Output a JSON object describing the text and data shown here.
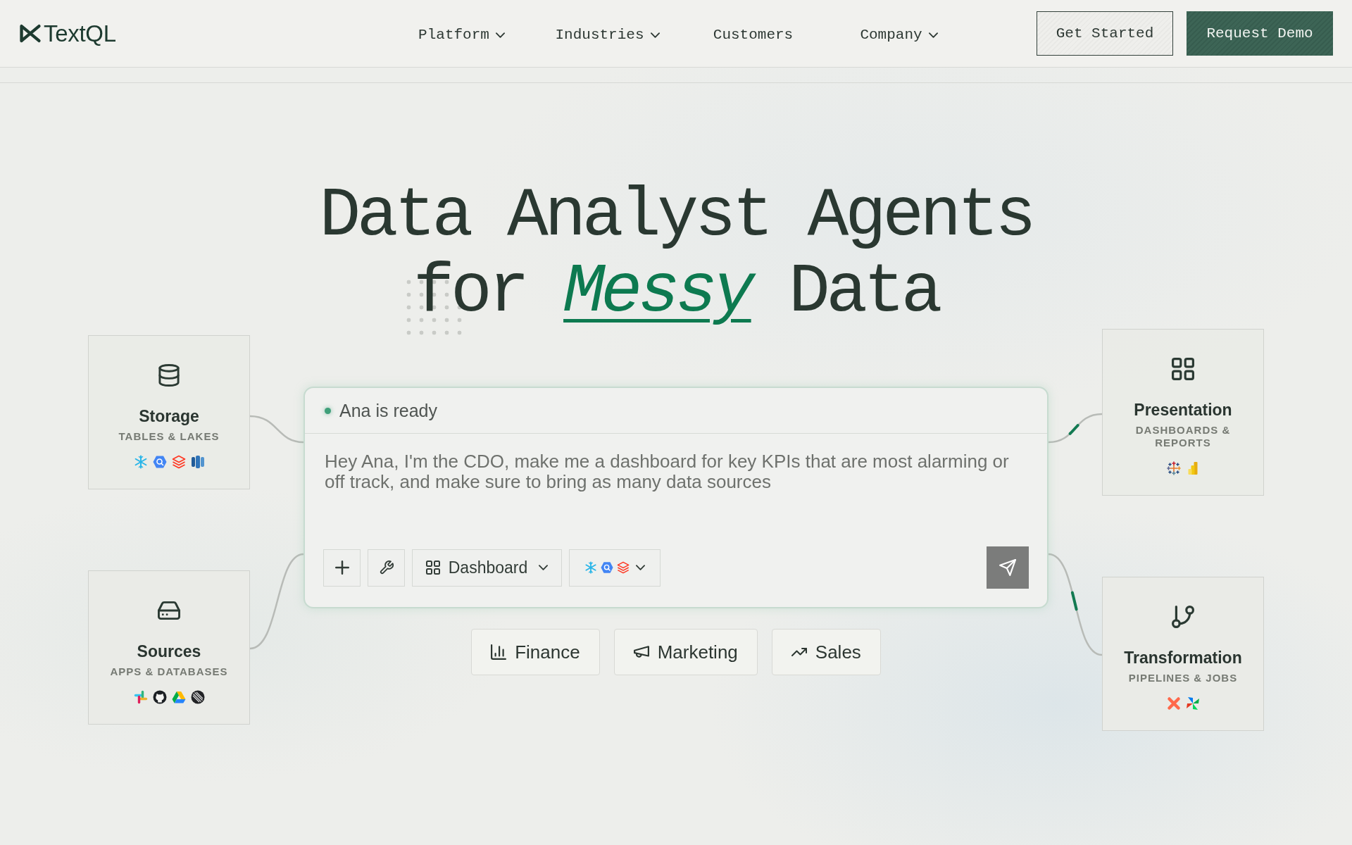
{
  "nav": {
    "logo": "TextQL",
    "links": [
      {
        "label": "Platform",
        "dropdown": true
      },
      {
        "label": "Industries",
        "dropdown": true
      },
      {
        "label": "Customers",
        "dropdown": false
      },
      {
        "label": "Company",
        "dropdown": true
      }
    ],
    "buttons": [
      {
        "label": "Get Started",
        "kind": "outline"
      },
      {
        "label": "Request Demo",
        "kind": "primary"
      }
    ]
  },
  "hero": {
    "title_lines": [
      "Data Analyst Agents",
      "for *Messy* Data"
    ]
  },
  "left_cards": [
    {
      "title": "Storage",
      "subtitle": "TABLES & LAKES"
    },
    {
      "title": "Sources",
      "subtitle": "APPS & DATABASES"
    }
  ],
  "chat": {
    "status": "Ana is ready",
    "placeholder": "Hey Ana, I'm the CDO, make me a dashboard for key KPIs that are most alarming or off track, and make sure to bring as many data sources",
    "mode": "Dashboard"
  },
  "suggestions": [
    {
      "label": "Finance"
    },
    {
      "label": "Marketing"
    },
    {
      "label": "Sales"
    }
  ],
  "right_cards": [
    {
      "title": "Presentation",
      "subtitle": "DASHBOARDS & REPORTS"
    },
    {
      "title": "Transformation",
      "subtitle": "PIPELINES & JOBS"
    }
  ]
}
